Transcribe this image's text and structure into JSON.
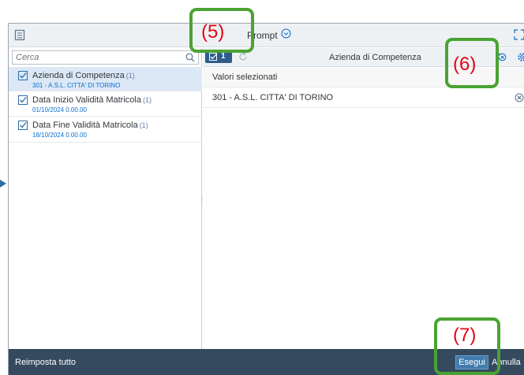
{
  "header": {
    "title": "Prompt"
  },
  "search": {
    "placeholder": "Cerca"
  },
  "prompts": [
    {
      "name": "Azienda di Competenza",
      "count": "(1)",
      "value": "301 - A.S.L. CITTA' DI TORINO"
    },
    {
      "name": "Data Inizio Validità Matricola",
      "count": "(1)",
      "value": "01/10/2024 0.00.00"
    },
    {
      "name": "Data Fine Validità Matricola",
      "count": "(1)",
      "value": "18/10/2024 0.00.00"
    }
  ],
  "right_panel": {
    "selected_count": "1",
    "title": "Azienda di Competenza",
    "values_header": "Valori selezionati",
    "values": [
      "301 - A.S.L. CITTA' DI TORINO"
    ]
  },
  "footer": {
    "reset_all": "Reimposta tutto",
    "run": "Esegui",
    "cancel": "Annulla"
  },
  "annotations": [
    {
      "label": "(5)"
    },
    {
      "label": "(6)"
    },
    {
      "label": "(7)"
    }
  ],
  "colors": {
    "accent": "#427cac",
    "footer_bg": "#354a5f",
    "selected_row_bg": "#dce8f6",
    "callout_border": "#4aa333",
    "callout_text": "#e30613",
    "link_value": "#0a6ed1"
  },
  "icons": {
    "panel": "panel-icon",
    "prompt_chevron": "chevron-down-circle-icon",
    "fullscreen": "fullscreen-icon",
    "search": "search-icon",
    "checkbox": "checkbox-icon",
    "refresh": "refresh-icon",
    "reset": "reset-icon",
    "settings": "settings-icon",
    "remove": "remove-circle-icon",
    "arrow": "arrow-right-icon"
  }
}
